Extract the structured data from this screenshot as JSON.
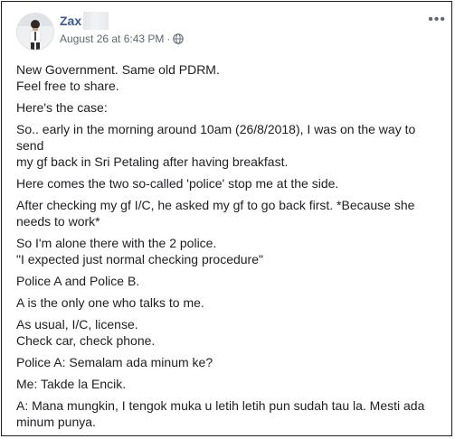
{
  "author": {
    "name": "Zax",
    "avatar_icon": "profile-photo"
  },
  "post_meta": {
    "timestamp": "August 26 at 6:43 PM",
    "separator": "·",
    "audience_icon": "globe-icon"
  },
  "menu": {
    "label": "•••"
  },
  "paragraphs": [
    {
      "lines": [
        "New Government. Same old PDRM.",
        "Feel free to share."
      ]
    },
    {
      "lines": [
        "Here's the case:"
      ]
    },
    {
      "lines": [
        "So.. early in the morning around 10am (26/8/2018), I was on the way to send",
        "my gf back in Sri Petaling after having breakfast."
      ]
    },
    {
      "lines": [
        "Here comes the two so-called 'police' stop me at the side."
      ]
    },
    {
      "lines": [
        "After checking my gf I/C, he asked my gf to go back first. *Because she",
        "needs to work*"
      ]
    },
    {
      "lines": [
        "So I'm alone there with the 2 police.",
        "\"I expected just normal checking procedure\""
      ]
    },
    {
      "lines": [
        "Police A and Police B."
      ]
    },
    {
      "lines": [
        "A is the only one who talks to me."
      ]
    },
    {
      "lines": [
        "As usual, I/C, license.",
        "Check car, check phone."
      ]
    },
    {
      "lines": [
        "Police A: Semalam ada minum ke?"
      ]
    },
    {
      "lines": [
        "Me: Takde la Encik."
      ]
    },
    {
      "lines": [
        "A: Mana mungkin, I tengok muka u letih letih pun sudah tau la. Mesti ada",
        "minum punya."
      ]
    }
  ],
  "colors": {
    "name": "#385898",
    "meta": "#616770",
    "text": "#1c1e21"
  }
}
